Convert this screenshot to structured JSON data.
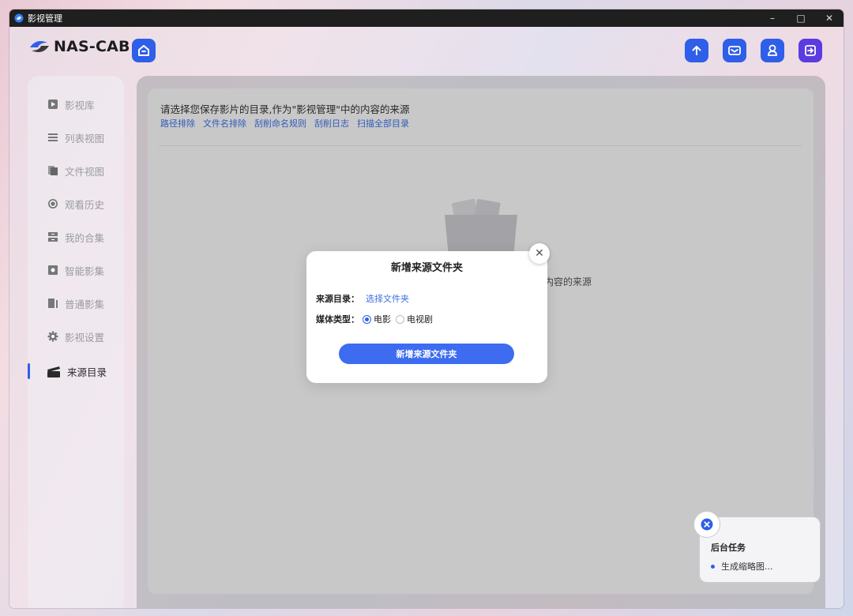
{
  "window": {
    "title": "影视管理",
    "controls": [
      "–",
      "□",
      "✕"
    ]
  },
  "header": {
    "logo_text": "NAS-CAB",
    "home_icon": "home-icon",
    "right_icons": [
      "upload-icon",
      "mail-icon",
      "user-icon",
      "logout-icon"
    ]
  },
  "sidebar": {
    "items": [
      {
        "label": "影视库",
        "icon": "play-square-icon"
      },
      {
        "label": "列表视图",
        "icon": "list-icon"
      },
      {
        "label": "文件视图",
        "icon": "files-icon"
      },
      {
        "label": "观看历史",
        "icon": "clock-icon"
      },
      {
        "label": "我的合集",
        "icon": "collection-icon"
      },
      {
        "label": "智能影集",
        "icon": "smart-album-icon"
      },
      {
        "label": "普通影集",
        "icon": "album-icon"
      },
      {
        "label": "影视设置",
        "icon": "gear-icon"
      },
      {
        "label": "来源目录",
        "icon": "clapper-icon"
      }
    ],
    "active_index": 8
  },
  "main": {
    "title": "请选择您保存影片的目录,作为\"影视管理\"中的内容的来源",
    "links": [
      "路径排除",
      "文件名排除",
      "刮削命名规则",
      "刮削日志",
      "扫描全部目录"
    ],
    "empty_text": "的内容的来源"
  },
  "dialog": {
    "title": "新增来源文件夹",
    "source_label": "来源目录：",
    "source_link": "选择文件夹",
    "media_label": "媒体类型：",
    "media_options": [
      "电影",
      "电视剧"
    ],
    "media_selected": 0,
    "submit_label": "新增来源文件夹"
  },
  "tasks": {
    "title": "后台任务",
    "items": [
      "生成缩略图..."
    ]
  },
  "colors": {
    "accent": "#2f5fe8",
    "logout": "#5b3ce0"
  }
}
